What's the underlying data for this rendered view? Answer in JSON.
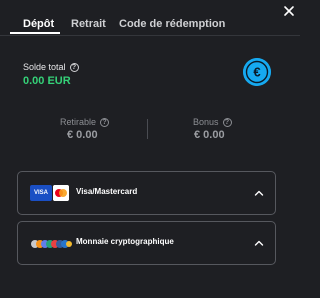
{
  "tabs": [
    {
      "label": "Dépôt",
      "active": true
    },
    {
      "label": "Retrait",
      "active": false
    },
    {
      "label": "Code de rédemption",
      "active": false
    }
  ],
  "balance": {
    "label": "Solde total",
    "value": "0.00 EUR",
    "currency_icon": "euro-icon",
    "value_color": "#35d178",
    "badge_color": "#16a9f0"
  },
  "stats": {
    "withdrawable": {
      "label": "Retirable",
      "value": "€ 0.00"
    },
    "bonus": {
      "label": "Bonus",
      "value": "€ 0.00"
    }
  },
  "methods": [
    {
      "label": "Visa/Mastercard",
      "logo_text": "VISA",
      "icon": "visa-mastercard-logo"
    },
    {
      "label": "Monnaie cryptographique",
      "icon": "crypto-logos"
    }
  ]
}
